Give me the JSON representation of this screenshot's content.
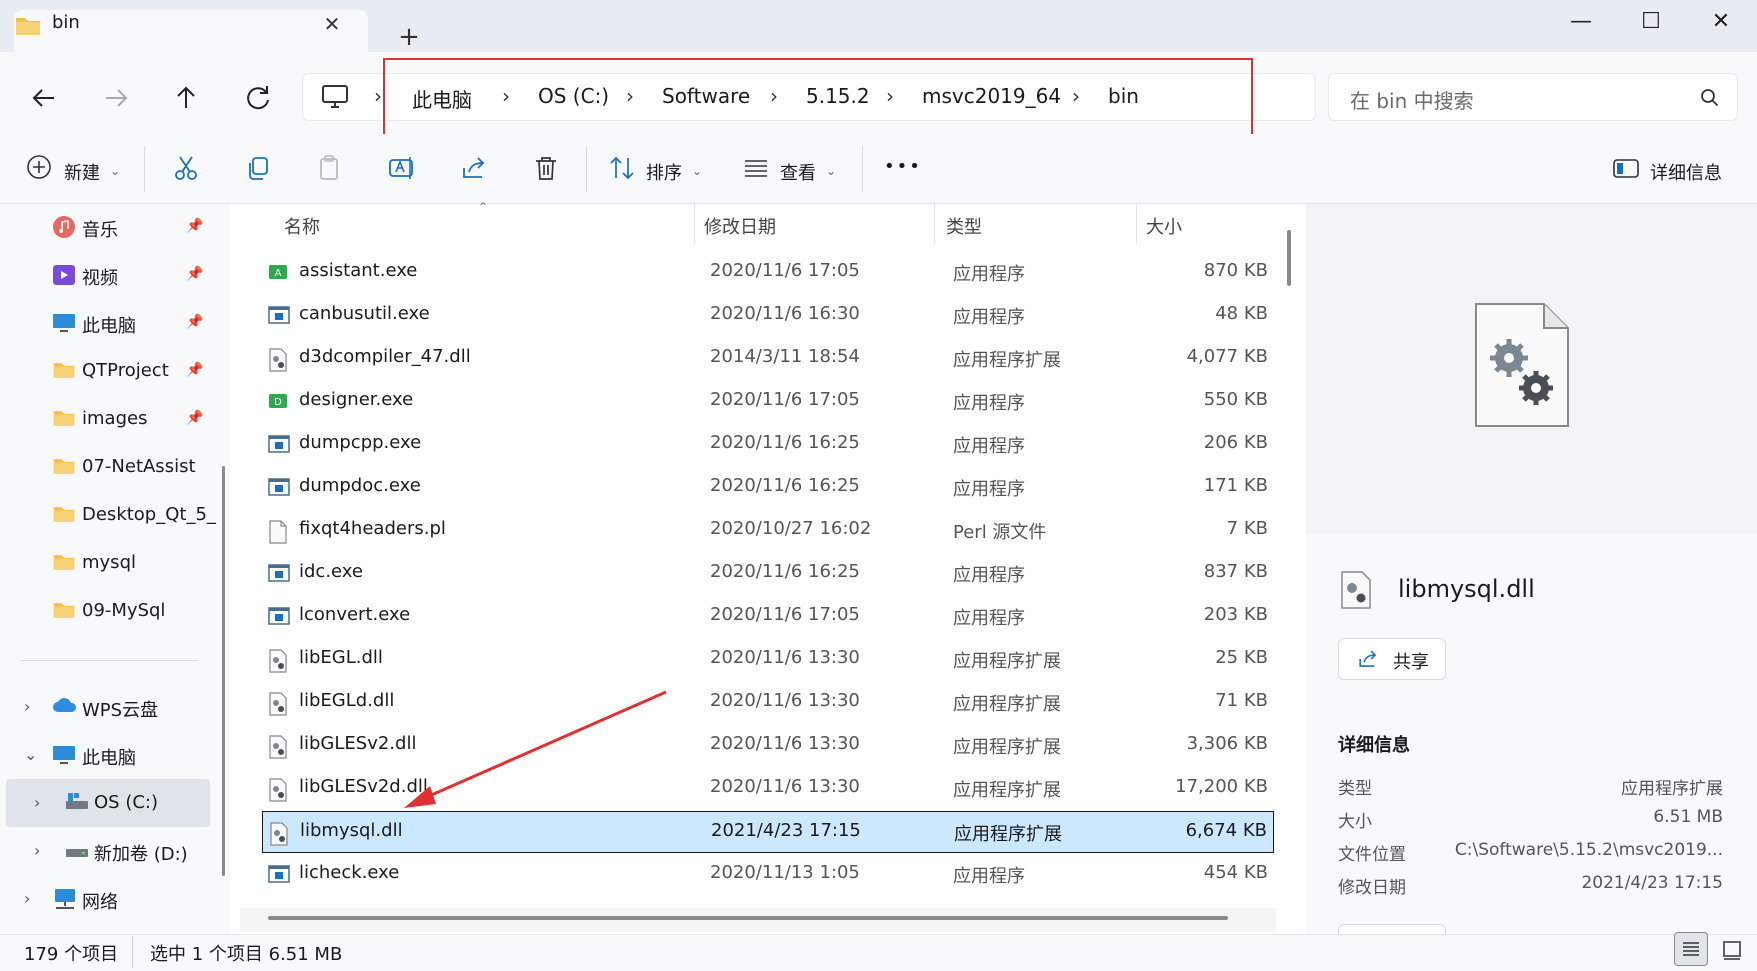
{
  "window": {
    "tab_title": "bin",
    "minimize_glyph": "—",
    "maximize_glyph": "☐",
    "close_glyph": "✕"
  },
  "address": {
    "crumbs": [
      "此电脑",
      "OS (C:)",
      "Software",
      "5.15.2",
      "msvc2019_64",
      "bin"
    ]
  },
  "search": {
    "placeholder": "在 bin 中搜索"
  },
  "toolbar": {
    "new_label": "新建",
    "sort_label": "排序",
    "view_label": "查看",
    "more_label": "•••",
    "details_label": "详细信息"
  },
  "sidebar": {
    "quick_access": [
      {
        "label": "音乐",
        "icon": "music-icon",
        "pinned": true
      },
      {
        "label": "视频",
        "icon": "video-icon",
        "pinned": true
      },
      {
        "label": "此电脑",
        "icon": "computer-icon",
        "pinned": true
      },
      {
        "label": "QTProject",
        "icon": "folder-icon",
        "pinned": true
      },
      {
        "label": "images",
        "icon": "folder-icon",
        "pinned": true
      },
      {
        "label": "07-NetAssist",
        "icon": "folder-icon",
        "pinned": false
      },
      {
        "label": "Desktop_Qt_5_",
        "icon": "folder-icon",
        "pinned": false
      },
      {
        "label": "mysql",
        "icon": "folder-icon",
        "pinned": false
      },
      {
        "label": "09-MySql",
        "icon": "folder-icon",
        "pinned": false
      }
    ],
    "tree": [
      {
        "label": "WPS云盘",
        "icon": "cloud-icon",
        "chevron": "›"
      },
      {
        "label": "此电脑",
        "icon": "computer-icon",
        "chevron": "⌄"
      },
      {
        "label": "OS (C:)",
        "icon": "drive-c-icon",
        "chevron": "›"
      },
      {
        "label": "新加卷 (D:)",
        "icon": "drive-icon",
        "chevron": "›"
      },
      {
        "label": "网络",
        "icon": "network-icon",
        "chevron": "›"
      }
    ]
  },
  "filelist": {
    "columns": {
      "name": "名称",
      "date": "修改日期",
      "type": "类型",
      "size": "大小"
    },
    "rows": [
      {
        "name": "assistant.exe",
        "date": "2020/11/6 17:05",
        "type": "应用程序",
        "size": "870 KB",
        "icon": "assistant-app-icon"
      },
      {
        "name": "canbusutil.exe",
        "date": "2020/11/6 16:30",
        "type": "应用程序",
        "size": "48 KB",
        "icon": "exe-icon"
      },
      {
        "name": "d3dcompiler_47.dll",
        "date": "2014/3/11 18:54",
        "type": "应用程序扩展",
        "size": "4,077 KB",
        "icon": "dll-icon"
      },
      {
        "name": "designer.exe",
        "date": "2020/11/6 17:05",
        "type": "应用程序",
        "size": "550 KB",
        "icon": "designer-app-icon"
      },
      {
        "name": "dumpcpp.exe",
        "date": "2020/11/6 16:25",
        "type": "应用程序",
        "size": "206 KB",
        "icon": "exe-icon"
      },
      {
        "name": "dumpdoc.exe",
        "date": "2020/11/6 16:25",
        "type": "应用程序",
        "size": "171 KB",
        "icon": "exe-icon"
      },
      {
        "name": "fixqt4headers.pl",
        "date": "2020/10/27 16:02",
        "type": "Perl 源文件",
        "size": "7 KB",
        "icon": "file-icon"
      },
      {
        "name": "idc.exe",
        "date": "2020/11/6 16:25",
        "type": "应用程序",
        "size": "837 KB",
        "icon": "exe-icon"
      },
      {
        "name": "lconvert.exe",
        "date": "2020/11/6 17:05",
        "type": "应用程序",
        "size": "203 KB",
        "icon": "exe-icon"
      },
      {
        "name": "libEGL.dll",
        "date": "2020/11/6 13:30",
        "type": "应用程序扩展",
        "size": "25 KB",
        "icon": "dll-icon"
      },
      {
        "name": "libEGLd.dll",
        "date": "2020/11/6 13:30",
        "type": "应用程序扩展",
        "size": "71 KB",
        "icon": "dll-icon"
      },
      {
        "name": "libGLESv2.dll",
        "date": "2020/11/6 13:30",
        "type": "应用程序扩展",
        "size": "3,306 KB",
        "icon": "dll-icon"
      },
      {
        "name": "libGLESv2d.dll",
        "date": "2020/11/6 13:30",
        "type": "应用程序扩展",
        "size": "17,200 KB",
        "icon": "dll-icon"
      },
      {
        "name": "libmysql.dll",
        "date": "2021/4/23 17:15",
        "type": "应用程序扩展",
        "size": "6,674 KB",
        "icon": "dll-icon",
        "selected": true
      },
      {
        "name": "licheck.exe",
        "date": "2020/11/13 1:05",
        "type": "应用程序",
        "size": "454 KB",
        "icon": "exe-icon"
      }
    ]
  },
  "details": {
    "filename": "libmysql.dll",
    "share_label": "共享",
    "heading": "详细信息",
    "props": [
      {
        "key": "类型",
        "value": "应用程序扩展"
      },
      {
        "key": "大小",
        "value": "6.51 MB"
      },
      {
        "key": "文件位置",
        "value": "C:\\Software\\5.15.2\\msvc2019..."
      },
      {
        "key": "修改日期",
        "value": "2021/4/23 17:15"
      }
    ]
  },
  "status": {
    "count": "179 个项目",
    "selection": "选中 1 个项目  6.51 MB"
  },
  "colors": {
    "accent": "#0067c0",
    "selection_bg": "#cce8ff",
    "annotation_red": "#e03030",
    "folder_yellow": "#f3c24b"
  }
}
